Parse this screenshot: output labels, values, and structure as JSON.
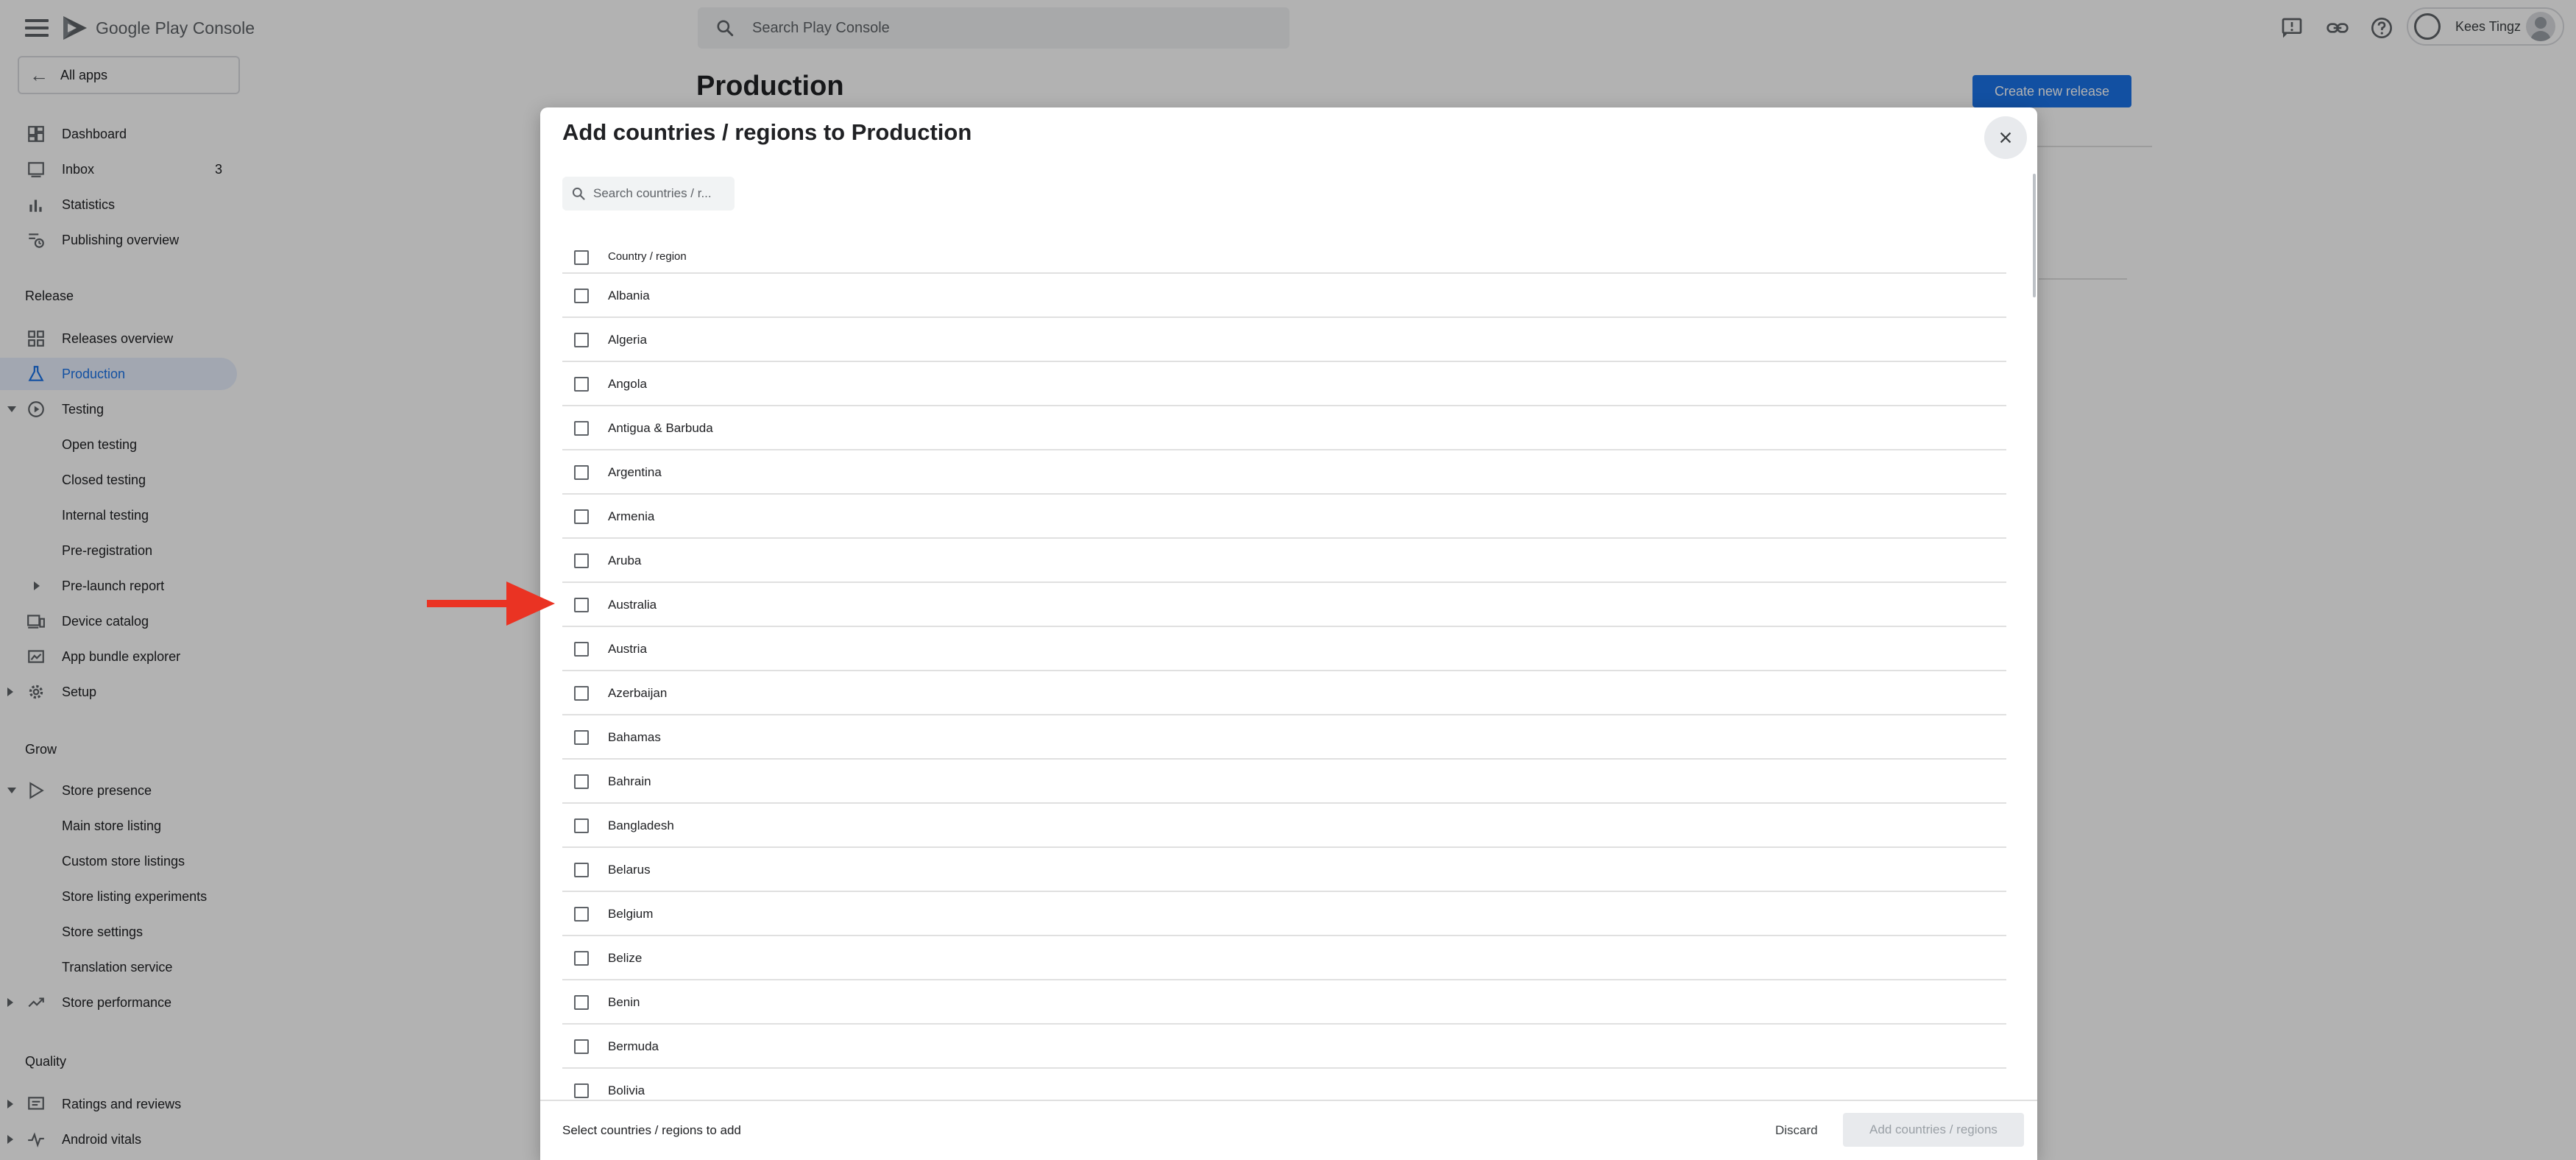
{
  "app": {
    "name": "Google Play Console"
  },
  "search": {
    "placeholder": "Search Play Console"
  },
  "user": {
    "name": "Kees Tingz"
  },
  "sidebar": {
    "all_apps": "All apps",
    "items": [
      {
        "label": "Dashboard",
        "icon": "dashboard-icon"
      },
      {
        "label": "Inbox",
        "icon": "inbox-icon",
        "count": "3"
      },
      {
        "label": "Statistics",
        "icon": "bar-chart-icon"
      },
      {
        "label": "Publishing overview",
        "icon": "publishing-icon"
      }
    ],
    "release_section": "Release",
    "release_items": [
      {
        "label": "Releases overview",
        "icon": "grid-icon"
      },
      {
        "label": "Production",
        "icon": "flask-icon",
        "active": true
      },
      {
        "label": "Testing",
        "icon": "play-circle-icon"
      },
      {
        "label": "Open testing"
      },
      {
        "label": "Closed testing"
      },
      {
        "label": "Internal testing"
      },
      {
        "label": "Pre-registration"
      },
      {
        "label": "Pre-launch report"
      },
      {
        "label": "Device catalog",
        "icon": "devices-icon"
      },
      {
        "label": "App bundle explorer",
        "icon": "bundle-icon"
      },
      {
        "label": "Setup",
        "icon": "gear-icon"
      }
    ],
    "grow_section": "Grow",
    "grow_items": [
      {
        "label": "Store presence",
        "icon": "play-outline-icon"
      },
      {
        "label": "Main store listing"
      },
      {
        "label": "Custom store listings"
      },
      {
        "label": "Store listing experiments"
      },
      {
        "label": "Store settings"
      },
      {
        "label": "Translation service"
      },
      {
        "label": "Store performance",
        "icon": "trending-icon"
      }
    ],
    "quality_section": "Quality",
    "quality_items": [
      {
        "label": "Ratings and reviews",
        "icon": "ratings-icon"
      },
      {
        "label": "Android vitals",
        "icon": "vitals-icon"
      }
    ]
  },
  "main": {
    "title": "Production",
    "create_release": "Create new release"
  },
  "dialog": {
    "title": "Add countries / regions to Production",
    "search_placeholder": "Search countries / r...",
    "column_header": "Country / region",
    "countries": [
      "Albania",
      "Algeria",
      "Angola",
      "Antigua & Barbuda",
      "Argentina",
      "Armenia",
      "Aruba",
      "Australia",
      "Austria",
      "Azerbaijan",
      "Bahamas",
      "Bahrain",
      "Bangladesh",
      "Belarus",
      "Belgium",
      "Belize",
      "Benin",
      "Bermuda",
      "Bolivia"
    ],
    "footer_hint": "Select countries / regions to add",
    "discard": "Discard",
    "add_button": "Add countries / regions"
  },
  "colors": {
    "accent": "#1a73e8",
    "active_bg": "#e8f0fe",
    "annotation_arrow": "#ea3323"
  }
}
